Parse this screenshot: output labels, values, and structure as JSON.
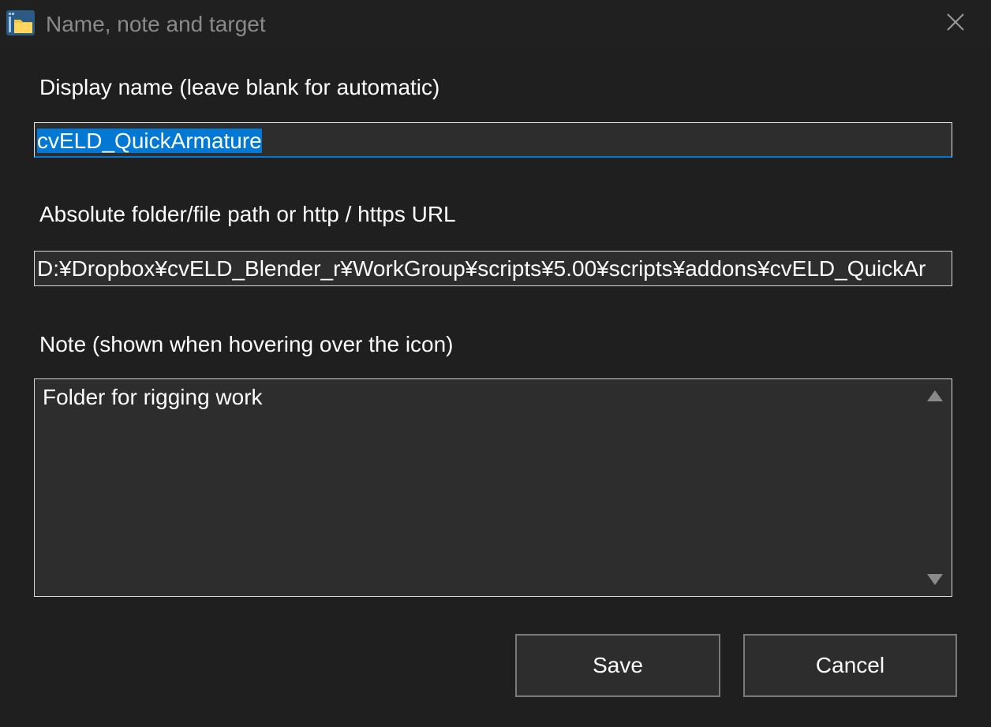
{
  "window": {
    "title": "Name, note and target"
  },
  "display_name": {
    "label": "Display name (leave blank for automatic)",
    "value": "cvELD_QuickArmature"
  },
  "path": {
    "label": "Absolute folder/file path or http / https URL",
    "value": "D:¥Dropbox¥cvELD_Blender_r¥WorkGroup¥scripts¥5.00¥scripts¥addons¥cvELD_QuickAr"
  },
  "note": {
    "label": "Note (shown when hovering over the icon)",
    "value": "Folder for rigging work"
  },
  "buttons": {
    "save_label": "Save",
    "cancel_label": "Cancel"
  },
  "icons": {
    "app": "folder-app-icon",
    "close": "close-icon",
    "scroll_up": "scroll-up-arrow-icon",
    "scroll_down": "scroll-down-arrow-icon"
  },
  "colors": {
    "background": "#1f1f1f",
    "field_background": "#2d2d2d",
    "accent": "#0078d4"
  }
}
